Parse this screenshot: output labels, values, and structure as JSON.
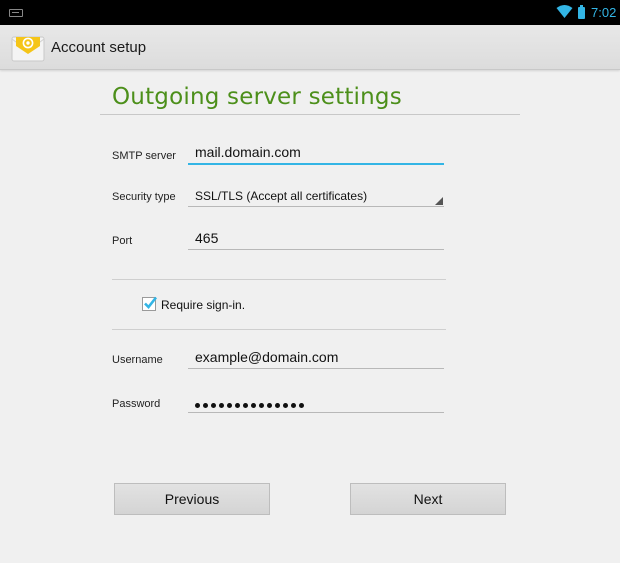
{
  "status_bar": {
    "time": "7:02",
    "icons": [
      "notification-icon",
      "wifi-icon",
      "battery-icon"
    ]
  },
  "action_bar": {
    "title": "Account setup",
    "icon": "email-app-icon"
  },
  "page": {
    "heading": "Outgoing server settings",
    "accent_color": "#4c8f1a",
    "focus_color": "#33b5e5"
  },
  "form": {
    "smtp_server": {
      "label": "SMTP server",
      "value": "mail.domain.com"
    },
    "security_type": {
      "label": "Security type",
      "value": "SSL/TLS (Accept all certificates)"
    },
    "port": {
      "label": "Port",
      "value": "465"
    },
    "require_signin": {
      "label": "Require sign-in.",
      "checked": true
    },
    "username": {
      "label": "Username",
      "value": "example@domain.com"
    },
    "password": {
      "label": "Password",
      "masked_length": 14
    }
  },
  "buttons": {
    "previous": "Previous",
    "next": "Next"
  }
}
